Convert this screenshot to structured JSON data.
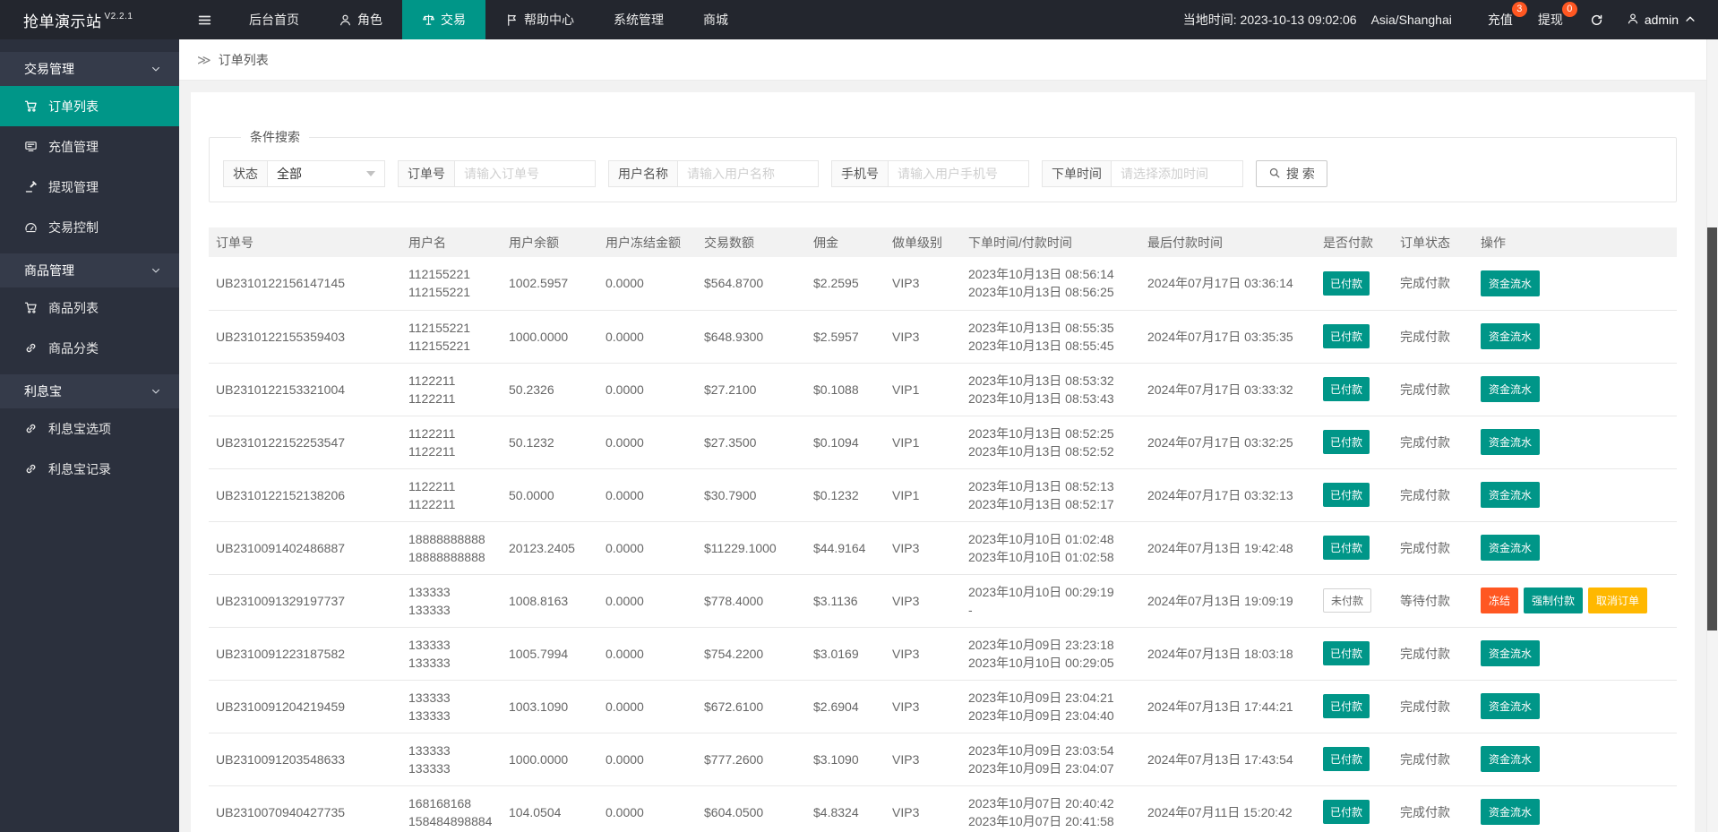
{
  "brand": {
    "name": "抢单演示站",
    "version": "V2.2.1"
  },
  "topnav": {
    "items": [
      {
        "label": "后台首页",
        "icon": null,
        "active": false
      },
      {
        "label": "角色",
        "icon": "user",
        "active": false
      },
      {
        "label": "交易",
        "icon": "scale",
        "active": true
      },
      {
        "label": "帮助中心",
        "icon": "flag",
        "active": false
      },
      {
        "label": "系统管理",
        "icon": null,
        "active": false
      },
      {
        "label": "商城",
        "icon": null,
        "active": false
      }
    ],
    "local_time": "当地时间: 2023-10-13 09:02:06",
    "timezone": "Asia/Shanghai",
    "recharge": {
      "label": "充值",
      "badge": "3"
    },
    "withdraw": {
      "label": "提现",
      "badge": "0"
    },
    "user": "admin"
  },
  "sidebar": {
    "items": [
      {
        "label": "交易管理",
        "type": "group"
      },
      {
        "label": "订单列表",
        "type": "item",
        "icon": "cart",
        "active": true
      },
      {
        "label": "充值管理",
        "type": "item",
        "icon": "board",
        "active": false
      },
      {
        "label": "提现管理",
        "type": "item",
        "icon": "gavel",
        "active": false
      },
      {
        "label": "交易控制",
        "type": "item",
        "icon": "gauge",
        "active": false
      },
      {
        "label": "商品管理",
        "type": "group"
      },
      {
        "label": "商品列表",
        "type": "item",
        "icon": "cart",
        "active": false
      },
      {
        "label": "商品分类",
        "type": "item",
        "icon": "link",
        "active": false
      },
      {
        "label": "利息宝",
        "type": "group"
      },
      {
        "label": "利息宝选项",
        "type": "item",
        "icon": "link",
        "active": false
      },
      {
        "label": "利息宝记录",
        "type": "item",
        "icon": "link",
        "active": false
      }
    ]
  },
  "breadcrumb": "订单列表",
  "filter": {
    "legend": "条件搜索",
    "status": {
      "label": "状态",
      "value": "全部"
    },
    "order_no": {
      "label": "订单号",
      "placeholder": "请输入订单号"
    },
    "username": {
      "label": "用户名称",
      "placeholder": "请输入用户名称"
    },
    "phone": {
      "label": "手机号",
      "placeholder": "请输入用户手机号"
    },
    "order_time": {
      "label": "下单时间",
      "placeholder": "请选择添加时间"
    },
    "search_label": "搜 索"
  },
  "table": {
    "headers": [
      "订单号",
      "用户名",
      "用户余额",
      "用户冻结金额",
      "交易数额",
      "佣金",
      "做单级别",
      "下单时间/付款时间",
      "最后付款时间",
      "是否付款",
      "订单状态",
      "操作"
    ],
    "rows": [
      {
        "order_no": "UB2310122156147145",
        "user": [
          "112155221",
          "112155221"
        ],
        "balance": "1002.5957",
        "frozen": "0.0000",
        "amount": "$564.8700",
        "commission": "$2.2595",
        "vip": "VIP3",
        "times": [
          "2023年10月13日 08:56:14",
          "2023年10月13日 08:56:25"
        ],
        "last_pay": "2024年07月17日 03:36:14",
        "paid": "已付款",
        "paid_type": "paid",
        "status": "完成付款",
        "actions": [
          {
            "label": "资金流水",
            "color": "teal"
          }
        ]
      },
      {
        "order_no": "UB2310122155359403",
        "user": [
          "112155221",
          "112155221"
        ],
        "balance": "1000.0000",
        "frozen": "0.0000",
        "amount": "$648.9300",
        "commission": "$2.5957",
        "vip": "VIP3",
        "times": [
          "2023年10月13日 08:55:35",
          "2023年10月13日 08:55:45"
        ],
        "last_pay": "2024年07月17日 03:35:35",
        "paid": "已付款",
        "paid_type": "paid",
        "status": "完成付款",
        "actions": [
          {
            "label": "资金流水",
            "color": "teal"
          }
        ]
      },
      {
        "order_no": "UB2310122153321004",
        "user": [
          "1122211",
          "1122211"
        ],
        "balance": "50.2326",
        "frozen": "0.0000",
        "amount": "$27.2100",
        "commission": "$0.1088",
        "vip": "VIP1",
        "times": [
          "2023年10月13日 08:53:32",
          "2023年10月13日 08:53:43"
        ],
        "last_pay": "2024年07月17日 03:33:32",
        "paid": "已付款",
        "paid_type": "paid",
        "status": "完成付款",
        "actions": [
          {
            "label": "资金流水",
            "color": "teal"
          }
        ]
      },
      {
        "order_no": "UB2310122152253547",
        "user": [
          "1122211",
          "1122211"
        ],
        "balance": "50.1232",
        "frozen": "0.0000",
        "amount": "$27.3500",
        "commission": "$0.1094",
        "vip": "VIP1",
        "times": [
          "2023年10月13日 08:52:25",
          "2023年10月13日 08:52:52"
        ],
        "last_pay": "2024年07月17日 03:32:25",
        "paid": "已付款",
        "paid_type": "paid",
        "status": "完成付款",
        "actions": [
          {
            "label": "资金流水",
            "color": "teal"
          }
        ]
      },
      {
        "order_no": "UB2310122152138206",
        "user": [
          "1122211",
          "1122211"
        ],
        "balance": "50.0000",
        "frozen": "0.0000",
        "amount": "$30.7900",
        "commission": "$0.1232",
        "vip": "VIP1",
        "times": [
          "2023年10月13日 08:52:13",
          "2023年10月13日 08:52:17"
        ],
        "last_pay": "2024年07月17日 03:32:13",
        "paid": "已付款",
        "paid_type": "paid",
        "status": "完成付款",
        "actions": [
          {
            "label": "资金流水",
            "color": "teal"
          }
        ]
      },
      {
        "order_no": "UB2310091402486887",
        "user": [
          "18888888888",
          "18888888888"
        ],
        "balance": "20123.2405",
        "frozen": "0.0000",
        "amount": "$11229.1000",
        "commission": "$44.9164",
        "vip": "VIP3",
        "times": [
          "2023年10月10日 01:02:48",
          "2023年10月10日 01:02:58"
        ],
        "last_pay": "2024年07月13日 19:42:48",
        "paid": "已付款",
        "paid_type": "paid",
        "status": "完成付款",
        "actions": [
          {
            "label": "资金流水",
            "color": "teal"
          }
        ]
      },
      {
        "order_no": "UB2310091329197737",
        "user": [
          "133333",
          "133333"
        ],
        "balance": "1008.8163",
        "frozen": "0.0000",
        "amount": "$778.4000",
        "commission": "$3.1136",
        "vip": "VIP3",
        "times": [
          "2023年10月10日 00:29:19",
          "-"
        ],
        "last_pay": "2024年07月13日 19:09:19",
        "paid": "未付款",
        "paid_type": "unpaid",
        "status": "等待付款",
        "actions": [
          {
            "label": "冻结",
            "color": "red"
          },
          {
            "label": "强制付款",
            "color": "teal"
          },
          {
            "label": "取消订单",
            "color": "yellow"
          }
        ]
      },
      {
        "order_no": "UB2310091223187582",
        "user": [
          "133333",
          "133333"
        ],
        "balance": "1005.7994",
        "frozen": "0.0000",
        "amount": "$754.2200",
        "commission": "$3.0169",
        "vip": "VIP3",
        "times": [
          "2023年10月09日 23:23:18",
          "2023年10月10日 00:29:05"
        ],
        "last_pay": "2024年07月13日 18:03:18",
        "paid": "已付款",
        "paid_type": "paid",
        "status": "完成付款",
        "actions": [
          {
            "label": "资金流水",
            "color": "teal"
          }
        ]
      },
      {
        "order_no": "UB2310091204219459",
        "user": [
          "133333",
          "133333"
        ],
        "balance": "1003.1090",
        "frozen": "0.0000",
        "amount": "$672.6100",
        "commission": "$2.6904",
        "vip": "VIP3",
        "times": [
          "2023年10月09日 23:04:21",
          "2023年10月09日 23:04:40"
        ],
        "last_pay": "2024年07月13日 17:44:21",
        "paid": "已付款",
        "paid_type": "paid",
        "status": "完成付款",
        "actions": [
          {
            "label": "资金流水",
            "color": "teal"
          }
        ]
      },
      {
        "order_no": "UB2310091203548633",
        "user": [
          "133333",
          "133333"
        ],
        "balance": "1000.0000",
        "frozen": "0.0000",
        "amount": "$777.2600",
        "commission": "$3.1090",
        "vip": "VIP3",
        "times": [
          "2023年10月09日 23:03:54",
          "2023年10月09日 23:04:07"
        ],
        "last_pay": "2024年07月13日 17:43:54",
        "paid": "已付款",
        "paid_type": "paid",
        "status": "完成付款",
        "actions": [
          {
            "label": "资金流水",
            "color": "teal"
          }
        ]
      },
      {
        "order_no": "UB2310070940427735",
        "user": [
          "168168168",
          "158484898884"
        ],
        "balance": "104.0504",
        "frozen": "0.0000",
        "amount": "$604.0500",
        "commission": "$4.8324",
        "vip": "VIP3",
        "times": [
          "2023年10月07日 20:40:42",
          "2023年10月07日 20:41:58"
        ],
        "last_pay": "2024年07月11日 15:20:42",
        "paid": "已付款",
        "paid_type": "paid",
        "status": "完成付款",
        "actions": [
          {
            "label": "资金流水",
            "color": "teal"
          }
        ]
      }
    ]
  },
  "colors": {
    "accent": "#009688",
    "danger": "#ff5722",
    "warning": "#ffb800",
    "header_bg": "#23262e",
    "sidebar_bg": "#2b303d"
  }
}
